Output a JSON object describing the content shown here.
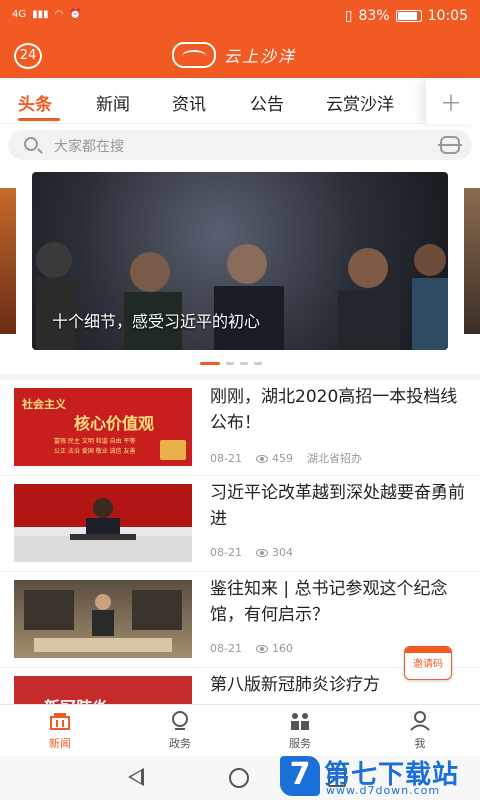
{
  "status_bar": {
    "network": "4G",
    "battery": "83%",
    "time": "10:05"
  },
  "app_bar": {
    "message_count": "24",
    "logo_text": "云上沙洋"
  },
  "tabs": [
    {
      "label": "头条",
      "active": true
    },
    {
      "label": "新闻",
      "active": false
    },
    {
      "label": "资讯",
      "active": false
    },
    {
      "label": "公告",
      "active": false
    },
    {
      "label": "云赏沙洋",
      "active": false
    }
  ],
  "tab_more_icon": "plus-icon",
  "search": {
    "placeholder": "大家都在搜"
  },
  "carousel": {
    "caption": "十个细节，感受习近平的初心",
    "active_index": 0,
    "count": 4
  },
  "news": [
    {
      "title": "刚刚，湖北2020高招一本投档线公布！",
      "date": "08-21",
      "views": "459",
      "source": "湖北省招办",
      "thumb_text": {
        "line1": "社会主义",
        "line2": "核心价值观",
        "line3": "富强 民主 文明 和谐 自由 平等",
        "line4": "公正 法治 爱国 敬业 诚信 友善"
      }
    },
    {
      "title": "习近平论改革越到深处越要奋勇前进",
      "date": "08-21",
      "views": "304",
      "source": ""
    },
    {
      "title": "鉴往知来 | 总书记参观这个纪念馆，有何启示？",
      "date": "08-21",
      "views": "160",
      "source": ""
    },
    {
      "title": "第八版新冠肺炎诊疗方",
      "date": "",
      "views": "",
      "source": "",
      "thumb_text": {
        "line1": "新冠肺炎"
      }
    }
  ],
  "invite_button": "邀请码",
  "bottom_nav": [
    {
      "label": "新闻",
      "icon": "news-icon",
      "active": true
    },
    {
      "label": "政务",
      "icon": "government-icon",
      "active": false
    },
    {
      "label": "服务",
      "icon": "service-icon",
      "active": false
    },
    {
      "label": "我",
      "icon": "profile-icon",
      "active": false
    }
  ],
  "watermark": {
    "text": "第七下载站",
    "url": "www.d7down.com",
    "letter": "7"
  },
  "colors": {
    "accent": "#f15a22",
    "watermark": "#1a6fd8"
  }
}
